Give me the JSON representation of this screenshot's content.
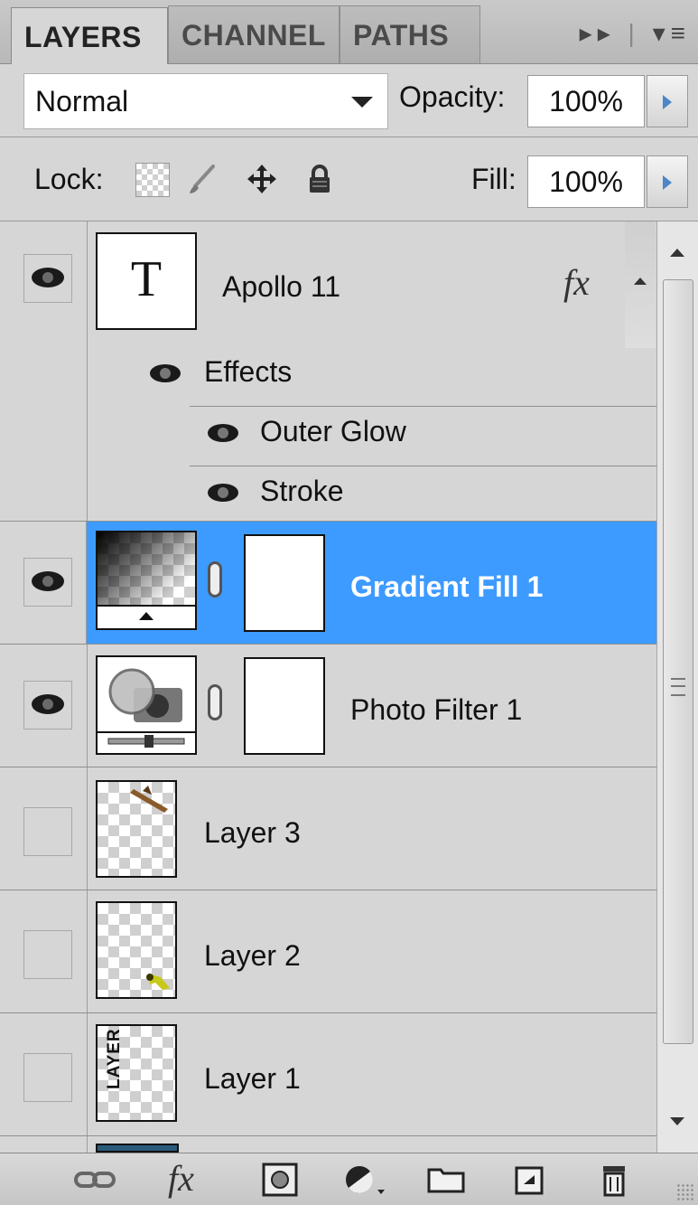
{
  "tabs": [
    {
      "label": "LAYERS",
      "active": true
    },
    {
      "label": "CHANNEL",
      "active": false
    },
    {
      "label": "PATHS",
      "active": false
    }
  ],
  "tab_menu": {
    "forward_icon": "double-arrow-icon",
    "menu_icon": "panel-menu-icon"
  },
  "blend_mode": {
    "value": "Normal"
  },
  "opacity": {
    "label": "Opacity:",
    "value": "100%"
  },
  "lock": {
    "label": "Lock:",
    "icons": [
      "lock-transparent-icon",
      "lock-brush-icon",
      "lock-move-icon",
      "lock-all-icon"
    ]
  },
  "fill": {
    "label": "Fill:",
    "value": "100%"
  },
  "layers": [
    {
      "name": "Apollo 11",
      "type": "text",
      "visible": true,
      "thumb_text": "T",
      "fx_label": "fx",
      "effects": {
        "label": "Effects",
        "items": [
          "Outer Glow",
          "Stroke"
        ]
      }
    },
    {
      "name": "Gradient Fill 1",
      "type": "gradient-fill",
      "visible": true,
      "selected": true
    },
    {
      "name": "Photo Filter 1",
      "type": "photo-filter",
      "visible": true
    },
    {
      "name": "Layer 3",
      "type": "pixel",
      "visible": false
    },
    {
      "name": "Layer 2",
      "type": "pixel",
      "visible": false
    },
    {
      "name": "Layer 1",
      "type": "pixel",
      "visible": false,
      "thumb_text": "LAYER"
    }
  ],
  "bottom_toolbar": {
    "icons": [
      "link-layers-icon",
      "fx-icon",
      "add-mask-icon",
      "adjustment-layer-icon",
      "new-group-icon",
      "new-layer-icon",
      "trash-icon"
    ],
    "fx_label": "fx"
  },
  "colors": {
    "selected_row": "#3d9bff",
    "panel_bg": "#d6d6d6",
    "accent_arrow": "#4a86c8"
  }
}
